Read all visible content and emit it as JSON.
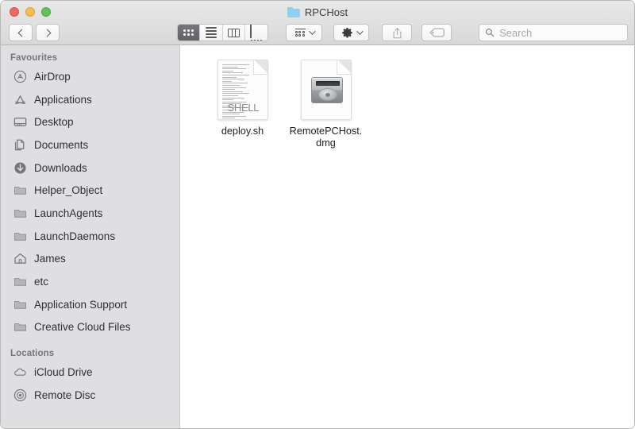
{
  "window": {
    "title": "RPCHost",
    "folder_icon": "folder-icon",
    "traffic_lights": {
      "close": "close-button",
      "minimize": "minimize-button",
      "maximize": "maximize-button",
      "close_color": "#ed6a5e",
      "minimize_color": "#f4bd4f",
      "maximize_color": "#61c454"
    }
  },
  "toolbar": {
    "back": "chevron-left-icon",
    "forward": "chevron-right-icon",
    "view_modes": [
      {
        "name": "icon-view",
        "icon": "grid-icon",
        "active": true
      },
      {
        "name": "list-view",
        "icon": "list-icon",
        "active": false
      },
      {
        "name": "column-view",
        "icon": "columns-icon",
        "active": false
      },
      {
        "name": "gallery-view",
        "icon": "gallery-icon",
        "active": false
      }
    ],
    "group_by": {
      "name": "group-by-button",
      "icon": "group-grid-icon"
    },
    "action": {
      "name": "action-button",
      "icon": "gear-icon"
    },
    "share": {
      "name": "share-button",
      "icon": "share-icon",
      "enabled": false
    },
    "tag": {
      "name": "tag-button",
      "icon": "tag-icon",
      "enabled": false
    },
    "search": {
      "placeholder": "Search",
      "value": "",
      "icon": "search-icon"
    }
  },
  "sidebar": {
    "sections": [
      {
        "header": "Favourites",
        "items": [
          {
            "label": "AirDrop",
            "icon": "airdrop-icon"
          },
          {
            "label": "Applications",
            "icon": "applications-icon"
          },
          {
            "label": "Desktop",
            "icon": "desktop-icon"
          },
          {
            "label": "Documents",
            "icon": "documents-icon"
          },
          {
            "label": "Downloads",
            "icon": "downloads-icon"
          },
          {
            "label": "Helper_Object",
            "icon": "folder-icon"
          },
          {
            "label": "LaunchAgents",
            "icon": "folder-icon"
          },
          {
            "label": "LaunchDaemons",
            "icon": "folder-icon"
          },
          {
            "label": "James",
            "icon": "home-icon"
          },
          {
            "label": "etc",
            "icon": "folder-icon"
          },
          {
            "label": "Application Support",
            "icon": "folder-icon"
          },
          {
            "label": "Creative Cloud Files",
            "icon": "folder-icon"
          }
        ]
      },
      {
        "header": "Locations",
        "items": [
          {
            "label": "iCloud Drive",
            "icon": "cloud-icon"
          },
          {
            "label": "Remote Disc",
            "icon": "disc-icon"
          }
        ]
      }
    ]
  },
  "main": {
    "files": [
      {
        "name": "deploy.sh",
        "icon": "shell-script-icon",
        "badge_text": "SHELL"
      },
      {
        "name": "RemotePCHost.dmg",
        "icon": "disk-image-icon"
      }
    ]
  }
}
